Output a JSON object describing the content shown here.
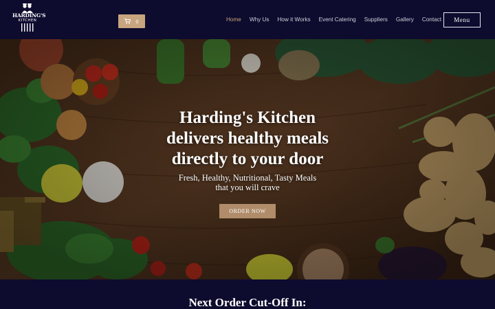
{
  "header": {
    "logo": {
      "line1": "HARDING'S",
      "line2": "KITCHEN"
    },
    "cart": {
      "icon": "cart-icon",
      "count": "0"
    },
    "nav": [
      {
        "label": "Home",
        "active": true
      },
      {
        "label": "Why Us"
      },
      {
        "label": "How it Works"
      },
      {
        "label": "Event Catering"
      },
      {
        "label": "Suppliers"
      },
      {
        "label": "Gallery"
      },
      {
        "label": "Contact"
      }
    ],
    "menu_label": "Menu"
  },
  "hero": {
    "headline": [
      "Harding's Kitchen",
      "delivers healthy meals",
      "directly to your door"
    ],
    "subline": [
      "Fresh, Healthy, Nutritional, Tasty Meals",
      "that you will crave"
    ],
    "cta": "ORDER NOW"
  },
  "section": {
    "heading": "Next Order Cut-Off In:"
  },
  "colors": {
    "navy": "#0d0b2e",
    "accent": "#c9a47a",
    "button": "#b08c6a"
  }
}
